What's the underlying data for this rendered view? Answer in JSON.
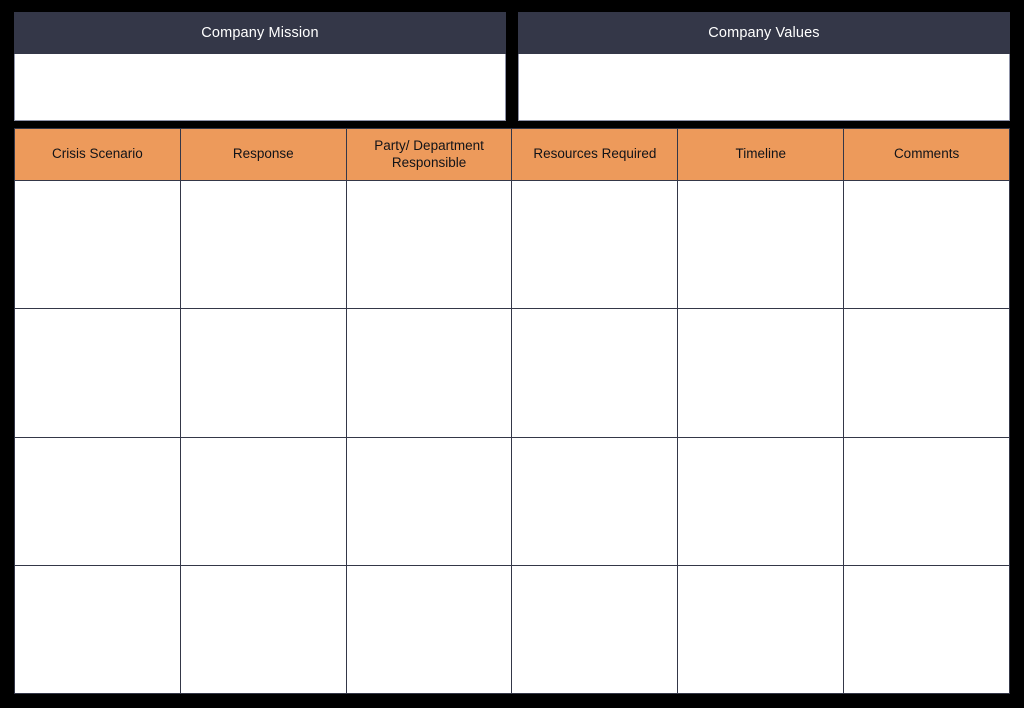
{
  "theme": {
    "background": "#000000",
    "panel_header_bg": "#343748",
    "panel_header_text": "#ffffff",
    "table_header_bg": "#ed9a5b",
    "table_header_text": "#111318",
    "grid_line": "#343748",
    "cell_bg": "#ffffff"
  },
  "panels": [
    {
      "title": "Company Mission",
      "body_text": ""
    },
    {
      "title": "Company Values",
      "body_text": ""
    }
  ],
  "table": {
    "columns": [
      "Crisis Scenario",
      "Response",
      "Party/ Department Responsible",
      "Resources Required",
      "Timeline",
      "Comments"
    ],
    "rows": [
      [
        "",
        "",
        "",
        "",
        "",
        ""
      ],
      [
        "",
        "",
        "",
        "",
        "",
        ""
      ],
      [
        "",
        "",
        "",
        "",
        "",
        ""
      ],
      [
        "",
        "",
        "",
        "",
        "",
        ""
      ]
    ]
  }
}
